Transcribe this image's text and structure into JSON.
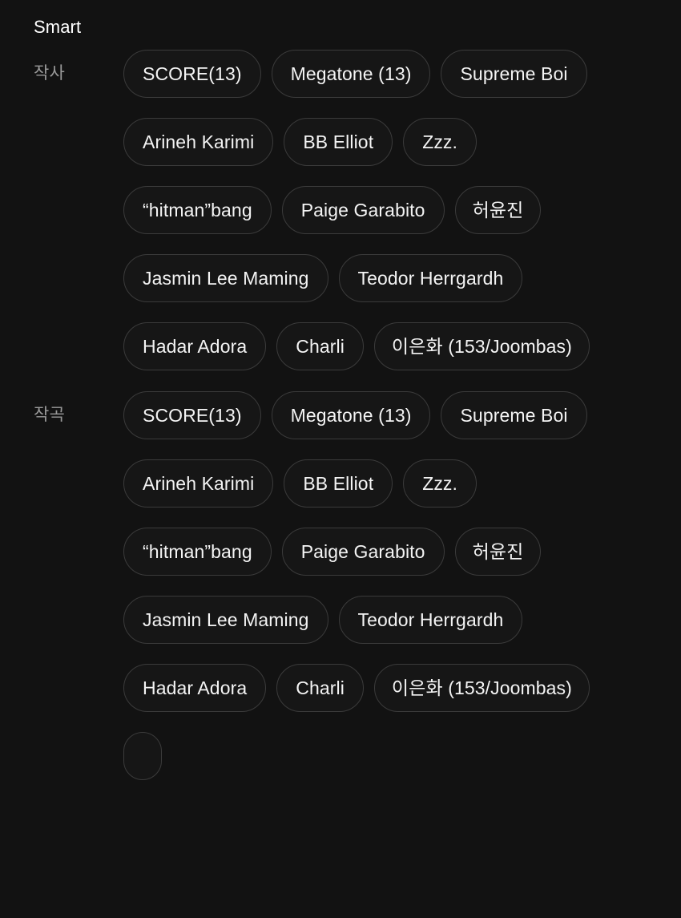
{
  "header": {
    "title": "Smart"
  },
  "sections": [
    {
      "label": "작사",
      "chips": [
        "SCORE(13)",
        "Megatone (13)",
        "Supreme Boi",
        "Arineh Karimi",
        "BB Elliot",
        "Zzz.",
        "“hitman”bang",
        "Paige Garabito",
        "허윤진",
        "Jasmin Lee Maming",
        "Teodor Herrgardh",
        "Hadar Adora",
        "Charli",
        "이은화 (153/Joombas)"
      ]
    },
    {
      "label": "작곡",
      "chips": [
        "SCORE(13)",
        "Megatone (13)",
        "Supreme Boi",
        "Arineh Karimi",
        "BB Elliot",
        "Zzz.",
        "“hitman”bang",
        "Paige Garabito",
        "허윤진",
        "Jasmin Lee Maming",
        "Teodor Herrgardh",
        "Hadar Adora",
        "Charli",
        "이은화 (153/Joombas)"
      ]
    }
  ],
  "clipped_chip": {
    "label": ""
  },
  "colors": {
    "background": "#121212",
    "chip_background": "#161616",
    "chip_border": "#3b3b3b",
    "chip_text": "#f4f4f4",
    "label_text": "#9a9a9a",
    "title_text": "#ffffff"
  }
}
